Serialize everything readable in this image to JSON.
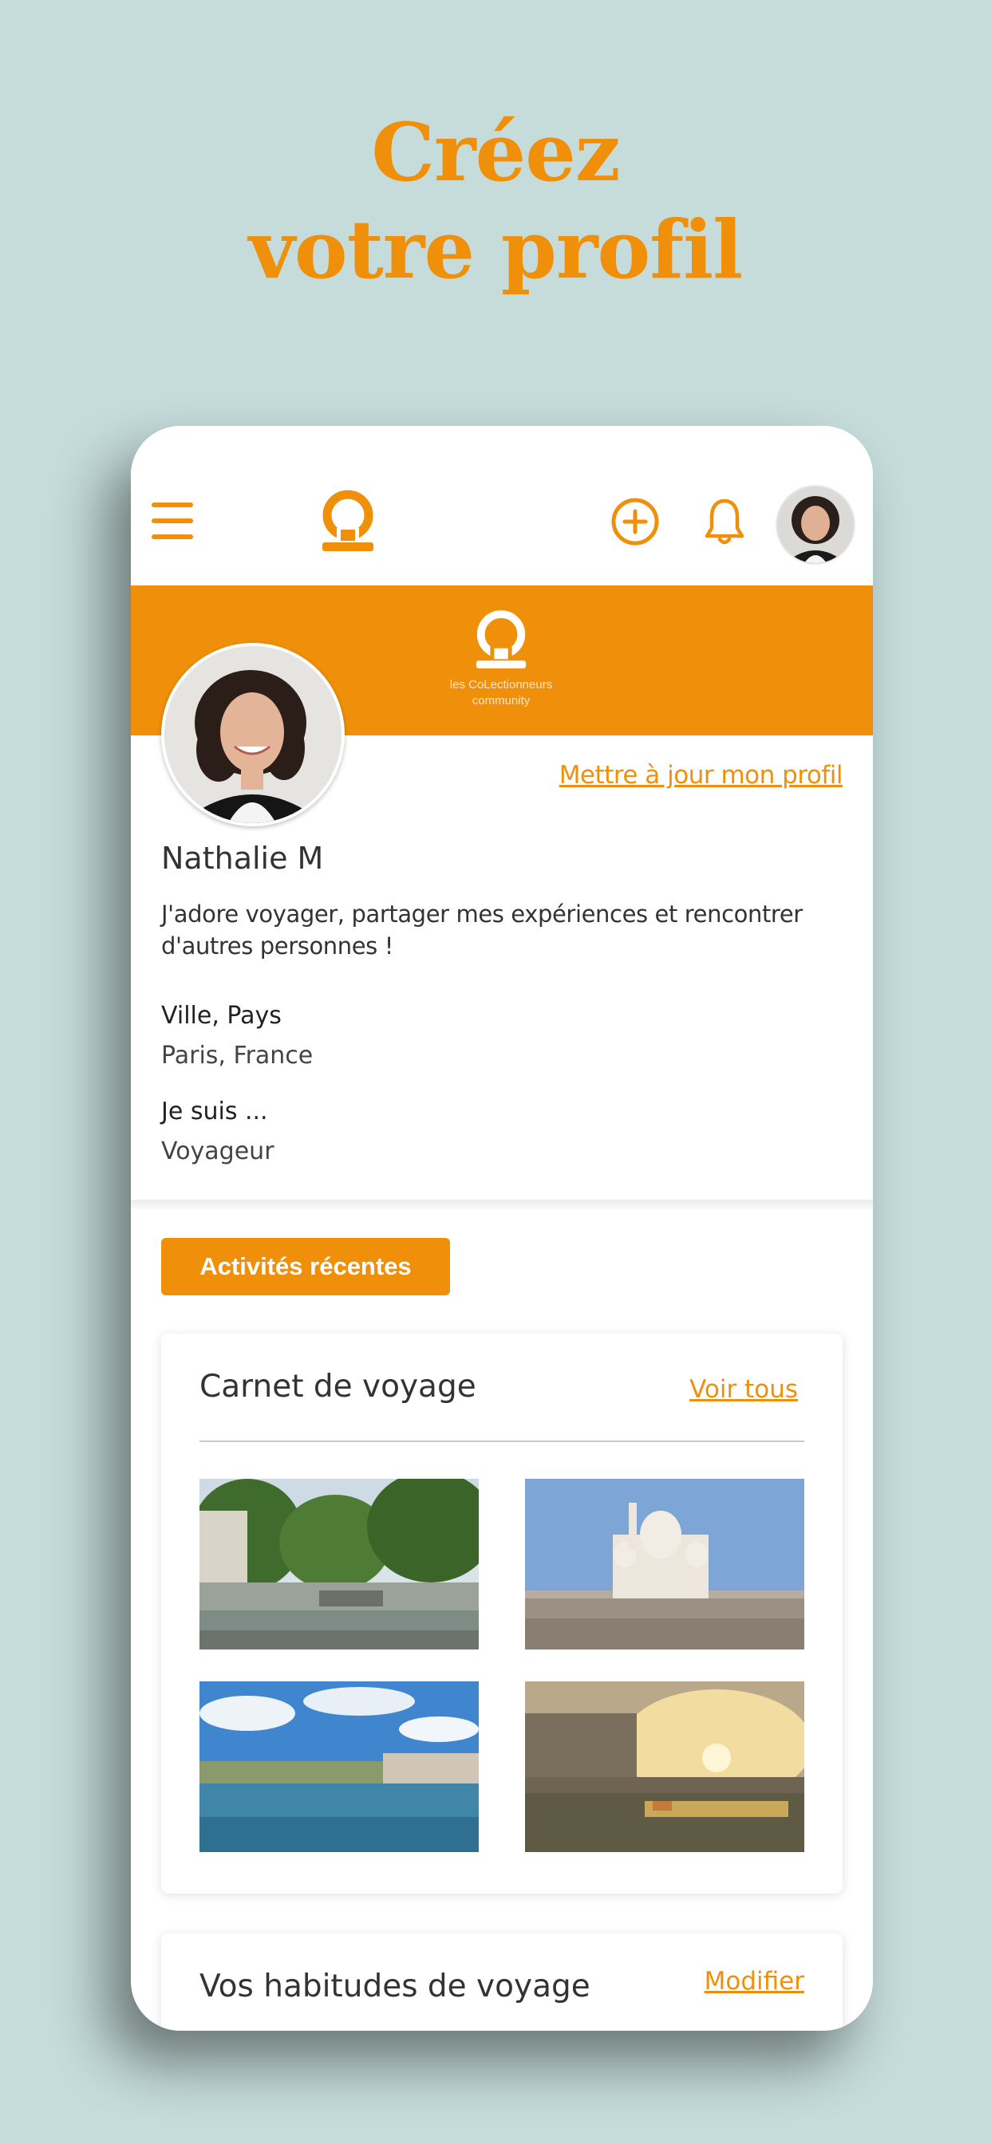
{
  "headline": {
    "line1": "Créez",
    "line2": "votre profil"
  },
  "colors": {
    "accent": "#f0900a",
    "background": "#c5dcdb"
  },
  "appbar": {
    "menu_icon": "hamburger-menu-icon",
    "logo_icon": "omega-logo-icon",
    "add_icon": "plus-circle-icon",
    "notifications_icon": "bell-icon"
  },
  "banner": {
    "brand_line1": "les CoLectionneurs",
    "brand_line2": "community"
  },
  "profile": {
    "update_link": "Mettre à jour mon profil",
    "name": "Nathalie M",
    "bio": "J'adore voyager, partager mes expériences et rencontrer d'autres personnes !",
    "location_label": "Ville, Pays",
    "location_value": "Paris, France",
    "role_label": "Je suis ...",
    "role_value": "Voyageur"
  },
  "recent_activity_button": "Activités récentes",
  "travel_journal": {
    "title": "Carnet de voyage",
    "see_all": "Voir tous",
    "photos": [
      "canal-photo",
      "sacre-coeur-photo",
      "seine-day-photo",
      "seine-sunset-photo"
    ]
  },
  "habits": {
    "title": "Vos habitudes de voyage",
    "edit": "Modifier"
  }
}
